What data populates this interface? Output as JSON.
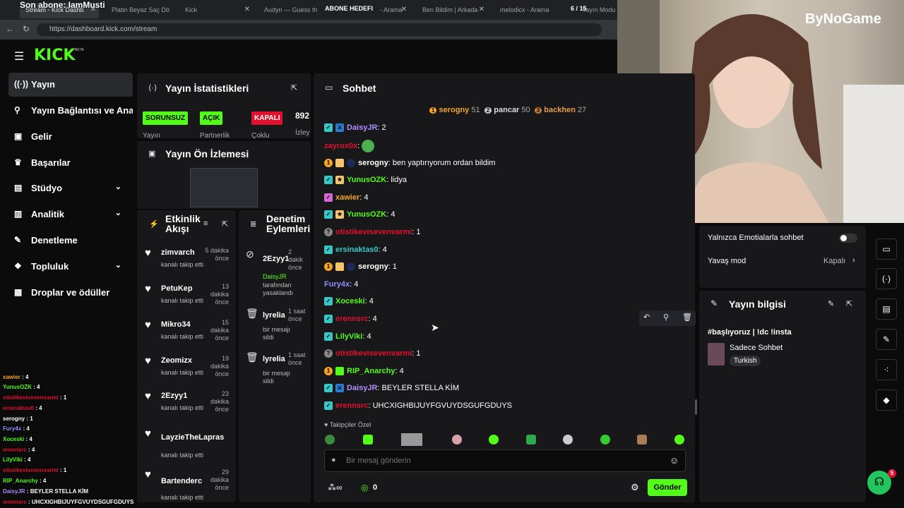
{
  "browser": {
    "overlay_title": "Son abone: IamMusti",
    "tabs": [
      {
        "label": "Stream - Kick Dashb",
        "active": true
      },
      {
        "label": "Platin Beyaz Saç Dö"
      },
      {
        "label": "Kick"
      },
      {
        "label": "Audyn — Guess th"
      },
      {
        "label": "- Arama"
      },
      {
        "label": "Ben Bildim | Arkada"
      },
      {
        "label": "melodicx - Arama"
      },
      {
        "label": "Yayın Modu | "
      }
    ],
    "url": "https://dashboard.kick.com/stream",
    "abone_label": "ABONE HEDEFI",
    "abone_count": "6 / 15",
    "sub_progress": 0.4
  },
  "overlay": {
    "bynogame": "ByNoGame"
  },
  "app": {
    "logo": "KICK",
    "beta": "BETA"
  },
  "sidebar": {
    "items": [
      {
        "label": "Yayın",
        "icon": "stream-icon"
      },
      {
        "label": "Yayın Bağlantısı ve Anahtar",
        "icon": "link-icon"
      },
      {
        "label": "Gelir",
        "icon": "money-icon"
      },
      {
        "label": "Başarılar",
        "icon": "trophy-icon"
      },
      {
        "label": "Stüdyo",
        "icon": "studio-icon"
      },
      {
        "label": "Analitik",
        "icon": "chart-icon"
      },
      {
        "label": "Denetleme",
        "icon": "wrench-icon"
      },
      {
        "label": "Topluluk",
        "icon": "community-icon"
      },
      {
        "label": "Droplar ve ödüller",
        "icon": "gift-icon"
      }
    ]
  },
  "stats": {
    "title": "Yayın İstatistikleri",
    "badges": [
      {
        "label": "SORUNSUZ",
        "caption": "Yayın",
        "color": "#53fc18"
      },
      {
        "label": "AÇIK",
        "caption": "Partnerlik",
        "color": "#53fc18"
      },
      {
        "label": "KAPALI",
        "caption": "Çoklu",
        "color": "#e0102f"
      }
    ],
    "viewers": "892",
    "viewers_caption": "İzley"
  },
  "preview": {
    "title": "Yayın Ön İzlemesi"
  },
  "activity": {
    "title": "Etkinlik Akışı",
    "items": [
      {
        "name": "zimvarch",
        "time": "5 dakika önce",
        "sub": "kanalı takip etti"
      },
      {
        "name": "PetuKep",
        "time": "13 dakika önce",
        "sub": "kanalı takip etti"
      },
      {
        "name": "Mikro34",
        "time": "15 dakika önce",
        "sub": "kanalı takip etti"
      },
      {
        "name": "Zeomizx",
        "time": "19 dakika önce",
        "sub": "kanalı takip etti"
      },
      {
        "name": "2Ezyy1",
        "time": "23 dakika önce",
        "sub": "kanalı takip etti"
      },
      {
        "name": "LayzieTheLapras",
        "time": "",
        "sub": "kanalı takip etti"
      },
      {
        "name": "Bartenderc",
        "time": "29 dakika önce",
        "sub": "kanalı takip etti"
      }
    ]
  },
  "moderation": {
    "title": "Denetim Eylemleri",
    "items": [
      {
        "name": "2Ezyy1",
        "time": "2 dakik önce",
        "sub1": "DaisyJR",
        "sub2": "tarafından yasaklandı"
      },
      {
        "name": "lyrelia",
        "time": "1 saat önce",
        "sub1": "bir mesajı",
        "sub2": "sildi"
      },
      {
        "name": "lyrelia",
        "time": "1 saat önce",
        "sub1": "bir mesajı",
        "sub2": "sildi"
      }
    ]
  },
  "chat": {
    "title": "Sohbet",
    "top_gifters": [
      {
        "rank": "1",
        "name": "serogny",
        "count": "51"
      },
      {
        "rank": "2",
        "name": "pancar",
        "count": "50"
      },
      {
        "rank": "3",
        "name": "backhen",
        "count": "27"
      }
    ],
    "messages": [
      {
        "user": "DaisyJR",
        "text": "2",
        "color": "#b28dff"
      },
      {
        "user": "zayrox0x",
        "text": "",
        "color": "#e0102f"
      },
      {
        "user": "serogny",
        "text": "ben yaptırıyorum ordan bildim",
        "color": "#ffffff"
      },
      {
        "user": "YunusOZK",
        "text": "lidya",
        "color": "#53fc18"
      },
      {
        "user": "xawier",
        "text": "4",
        "color": "#f5a623"
      },
      {
        "user": "YunusOZK",
        "text": "4",
        "color": "#53fc18"
      },
      {
        "user": "otistikevisevenvarmi",
        "text": "1",
        "color": "#e0102f"
      },
      {
        "user": "ersinaktas0",
        "text": "4",
        "color": "#36c7c7"
      },
      {
        "user": "serogny",
        "text": "1",
        "color": "#ffffff"
      },
      {
        "user": "Fury4x",
        "text": "4",
        "color": "#8f8fff"
      },
      {
        "user": "Xoceski",
        "text": "4",
        "color": "#53fc18"
      },
      {
        "user": "erennsrc",
        "text": "4",
        "color": "#e0102f"
      },
      {
        "user": "LilyViki",
        "text": "4",
        "color": "#53fc18"
      },
      {
        "user": "otistikevisevenvarmi",
        "text": "1",
        "color": "#e0102f"
      },
      {
        "user": "RIP_Anarchy",
        "text": "4",
        "color": "#53fc18"
      },
      {
        "user": "DaisyJR",
        "text": "BEYLER STELLA KİM",
        "color": "#b28dff"
      },
      {
        "user": "erennsrc",
        "text": "UHCXIGHBIJUYFGVUYDSGUFGDUYS",
        "color": "#e0102f"
      }
    ],
    "emote_header": "Takipçiler Özel",
    "input_placeholder": "Bir mesaj gönderin",
    "points": "0",
    "send_label": "Gönder"
  },
  "chat_settings": {
    "emote_only": "Yalnızca Emotialarla sohbet",
    "slow_mode": "Yavaş mod",
    "slow_value": "Kapalı"
  },
  "stream_info": {
    "title": "Yayın bilgisi",
    "stream_title": "#başlıyoruz | !dc !insta",
    "category": "Sadece Sohbet",
    "language": "Turkish"
  },
  "support_badge": "5",
  "mini_chat": [
    {
      "user": "xawier",
      "text": "4"
    },
    {
      "user": "YunusOZK",
      "text": "4"
    },
    {
      "user": "otistikevisevenvarmi",
      "text": "1"
    },
    {
      "user": "ersinaktas0",
      "text": "4"
    },
    {
      "user": "serogny",
      "text": "1"
    },
    {
      "user": "Fury4x",
      "text": "4"
    },
    {
      "user": "Xoceski",
      "text": "4"
    },
    {
      "user": "erennsrc",
      "text": "4"
    },
    {
      "user": "LilyViki",
      "text": "4"
    },
    {
      "user": "otistikevisevenvarmi",
      "text": "1"
    },
    {
      "user": "RIP_Anarchy",
      "text": "4"
    },
    {
      "user": "DaisyJR",
      "text": "BEYLER STELLA KİM"
    },
    {
      "user": "erennsrc",
      "text": "UHCXIGHBIJUYFGVUYDSGUFGDUYS"
    }
  ]
}
